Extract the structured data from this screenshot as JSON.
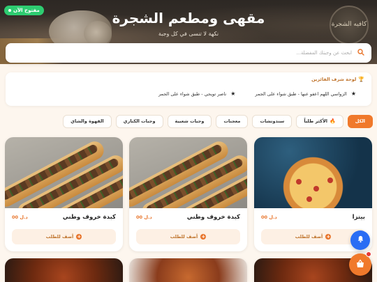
{
  "header": {
    "title": "مقهى ومطعم الشجرة",
    "subtitle": "نكهة لا تنسى في كل وجبة",
    "open_badge": "مفتوح الآن",
    "logo_text": "كافيه الشجرة"
  },
  "search": {
    "placeholder": "ابحث عن وجبتك المفضلة..."
  },
  "leaderboard": {
    "title": "لوحة شرف الفائزين",
    "winners": [
      {
        "text": "الزواسي اللهم اعفو عنها - طبق شواء على الجمر"
      },
      {
        "text": "ناصر تويجي - طبق شواء على الجمر"
      }
    ]
  },
  "categories": [
    {
      "label": "الكل",
      "active": true
    },
    {
      "label": "الأكثر طلباً",
      "active": false,
      "icon": "fire-icon"
    },
    {
      "label": "سندوتشات",
      "active": false
    },
    {
      "label": "معجنات",
      "active": false
    },
    {
      "label": "وجبات شعبية",
      "active": false
    },
    {
      "label": "وجبات الكناري",
      "active": false
    },
    {
      "label": "القهوة والشاي",
      "active": false
    }
  ],
  "products": [
    {
      "name": "بيتزا",
      "price": "00 د.ل",
      "add_label": "أضف للطلب",
      "image": "pizza"
    },
    {
      "name": "كبدة خروف وطني",
      "price": "00 د.ل",
      "add_label": "أضف للطلب",
      "image": "sandwich"
    },
    {
      "name": "كبدة خروف وطني",
      "price": "00 د.ل",
      "add_label": "أضف للطلب",
      "image": "sandwich"
    }
  ],
  "colors": {
    "accent": "#f0792b",
    "open_green": "#2ecc71",
    "bell_blue": "#2a6df4",
    "badge_red": "#e53935"
  },
  "icons": {
    "search": "search-icon",
    "trophy": "trophy-icon",
    "star": "star-icon",
    "bell": "bell-icon",
    "cart": "cart-icon"
  }
}
